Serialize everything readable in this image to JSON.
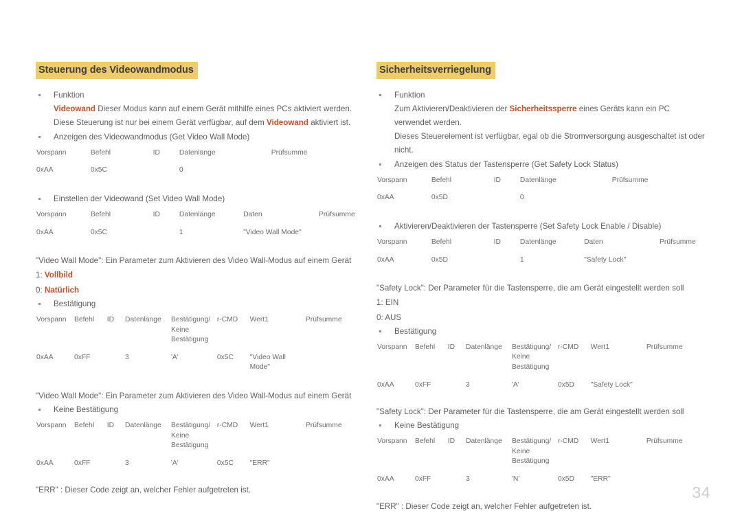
{
  "page": {
    "number": "34"
  },
  "left": {
    "title": "Steuerung des Videowandmodus",
    "func_label": "Funktion",
    "func_line1_strong": "Videowand",
    "func_line1_rest": " Dieser Modus kann auf einem Gerät mithilfe eines PCs aktiviert werden.",
    "func_line2_a": "Diese Steuerung ist nur bei einem Gerät verfügbar, auf dem ",
    "func_line2_strong": "Videowand",
    "func_line2_b": " aktiviert ist.",
    "get_bullet": "Anzeigen des Videowandmodus (Get Video Wall Mode)",
    "get_table": {
      "headers": [
        "Vorspann",
        "Befehl",
        "ID",
        "Datenlänge",
        "Prüfsumme"
      ],
      "values": [
        "0xAA",
        "0x5C",
        "",
        "0",
        ""
      ]
    },
    "set_bullet": "Einstellen der Videowand (Set Video Wall Mode)",
    "set_table": {
      "headers": [
        "Vorspann",
        "Befehl",
        "ID",
        "Datenlänge",
        "Daten",
        "Prüfsumme"
      ],
      "values": [
        "0xAA",
        "0x5C",
        "",
        "1",
        "\"Video Wall Mode\"",
        ""
      ]
    },
    "param_note": "\"Video Wall Mode\": Ein Parameter zum Aktivieren des Video Wall-Modus auf einem Gerät",
    "param_1_key": "1: ",
    "param_1_val": "Vollbild",
    "param_0_key": "0: ",
    "param_0_val": "Natürlich",
    "ack_bullet": "Bestätigung",
    "ack_table": {
      "headers": [
        "Vorspann",
        "Befehl",
        "ID",
        "Datenlänge",
        "Bestätigung/ Keine Bestätigung",
        "r-CMD",
        "Wert1",
        "Prüfsumme"
      ],
      "values": [
        "0xAA",
        "0xFF",
        "",
        "3",
        "'A'",
        "0x5C",
        "\"Video Wall Mode\"",
        ""
      ]
    },
    "param_note2": "\"Video Wall Mode\": Ein Parameter zum Aktivieren des Video Wall-Modus auf einem Gerät",
    "nack_bullet": "Keine Bestätigung",
    "nack_table": {
      "headers": [
        "Vorspann",
        "Befehl",
        "ID",
        "Datenlänge",
        "Bestätigung/ Keine Bestätigung",
        "r-CMD",
        "Wert1",
        "Prüfsumme"
      ],
      "values": [
        "0xAA",
        "0xFF",
        "",
        "3",
        "'A'",
        "0x5C",
        "\"ERR\"",
        ""
      ]
    },
    "err_note": "\"ERR\" : Dieser Code zeigt an, welcher Fehler aufgetreten ist."
  },
  "right": {
    "title": "Sicherheitsverriegelung",
    "func_label": "Funktion",
    "func_line1_a": "Zum Aktivieren/Deaktivieren der ",
    "func_line1_strong": "Sicherheitssperre",
    "func_line1_b": " eines Geräts kann ein PC verwendet werden.",
    "func_line2": "Dieses Steuerelement ist verfügbar, egal ob die Stromversorgung ausgeschaltet ist oder nicht.",
    "get_bullet": "Anzeigen des Status der Tastensperre (Get Safety Lock Status)",
    "get_table": {
      "headers": [
        "Vorspann",
        "Befehl",
        "ID",
        "Datenlänge",
        "Prüfsumme"
      ],
      "values": [
        "0xAA",
        "0x5D",
        "",
        "0",
        ""
      ]
    },
    "set_bullet": "Aktivieren/Deaktivieren der Tastensperre (Set Safety Lock Enable / Disable)",
    "set_table": {
      "headers": [
        "Vorspann",
        "Befehl",
        "ID",
        "Datenlänge",
        "Daten",
        "Prüfsumme"
      ],
      "values": [
        "0xAA",
        "0x5D",
        "",
        "1",
        "\"Safety Lock\"",
        ""
      ]
    },
    "param_note": "\"Safety Lock\": Der Parameter für die Tastensperre, die am Gerät eingestellt werden soll",
    "param_1": "1: EIN",
    "param_0": "0: AUS",
    "ack_bullet": "Bestätigung",
    "ack_table": {
      "headers": [
        "Vorspann",
        "Befehl",
        "ID",
        "Datenlänge",
        "Bestätigung/ Keine Bestätigung",
        "r-CMD",
        "Wert1",
        "Prüfsumme"
      ],
      "values": [
        "0xAA",
        "0xFF",
        "",
        "3",
        "'A'",
        "0x5D",
        "\"Safety Lock\"",
        ""
      ]
    },
    "param_note2": "\"Safety Lock\": Der Parameter für die Tastensperre, die am Gerät eingestellt werden soll",
    "nack_bullet": "Keine Bestätigung",
    "nack_table": {
      "headers": [
        "Vorspann",
        "Befehl",
        "ID",
        "Datenlänge",
        "Bestätigung/ Keine Bestätigung",
        "r-CMD",
        "Wert1",
        "Prüfsumme"
      ],
      "values": [
        "0xAA",
        "0xFF",
        "",
        "3",
        "'N'",
        "0x5D",
        "\"ERR\"",
        ""
      ]
    },
    "err_note": "\"ERR\" : Dieser Code zeigt an, welcher Fehler aufgetreten ist."
  },
  "colors": {
    "heading_bg": "#efcc6b",
    "accent_red": "#c9502a",
    "text": "#5e5e5e",
    "rule": "#bdbdbd",
    "page_number": "#c8cdd3"
  }
}
